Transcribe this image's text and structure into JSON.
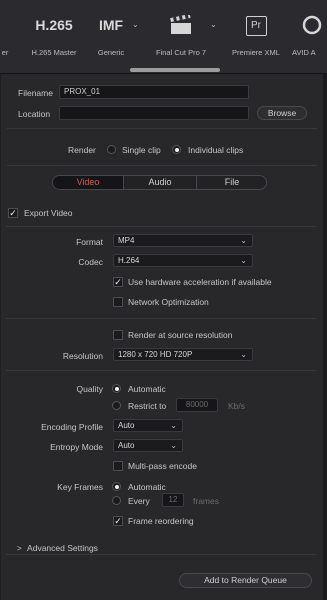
{
  "presets": [
    {
      "icon_text": "",
      "name": "er"
    },
    {
      "icon_text": "H.265",
      "name": "H.265 Master"
    },
    {
      "icon_text": "IMF",
      "name": "Generic"
    },
    {
      "icon_text": "",
      "name": "Final Cut Pro 7",
      "icon": "clapperboard-icon"
    },
    {
      "icon_text": "Pr",
      "name": "Premiere XML"
    },
    {
      "icon_text": "",
      "name": "AVID A"
    }
  ],
  "file": {
    "filename_label": "Filename",
    "filename_value": "PROX_01",
    "location_label": "Location",
    "location_value": "",
    "browse_label": "Browse"
  },
  "render": {
    "label": "Render",
    "single_clip": "Single clip",
    "individual_clips": "Individual clips",
    "selected": "individual_clips"
  },
  "tabs": [
    "Video",
    "Audio",
    "File"
  ],
  "active_tab": "Video",
  "video": {
    "export_video_label": "Export Video",
    "export_video_checked": true,
    "format_label": "Format",
    "format_value": "MP4",
    "codec_label": "Codec",
    "codec_value": "H.264",
    "hw_accel_label": "Use hardware acceleration if available",
    "hw_accel_checked": true,
    "network_opt_label": "Network Optimization",
    "network_opt_checked": false,
    "render_source_res_label": "Render at source resolution",
    "render_source_res_checked": false,
    "resolution_label": "Resolution",
    "resolution_value": "1280 x 720 HD 720P",
    "quality_label": "Quality",
    "quality_automatic": "Automatic",
    "quality_restrict": "Restrict to",
    "quality_restrict_value": "80000",
    "quality_unit": "Kb/s",
    "encoding_profile_label": "Encoding Profile",
    "encoding_profile_value": "Auto",
    "entropy_mode_label": "Entropy Mode",
    "entropy_mode_value": "Auto",
    "multipass_label": "Multi-pass encode",
    "multipass_checked": false,
    "keyframes_label": "Key Frames",
    "keyframes_automatic": "Automatic",
    "keyframes_every": "Every",
    "keyframes_every_value": "12",
    "keyframes_unit": "frames",
    "frame_reorder_label": "Frame reordering",
    "frame_reorder_checked": true
  },
  "advanced_settings_label": "Advanced Settings",
  "add_to_queue_label": "Add to Render Queue",
  "colors": {
    "accent": "#e0574a",
    "panel": "#28282b",
    "field": "#161618"
  }
}
